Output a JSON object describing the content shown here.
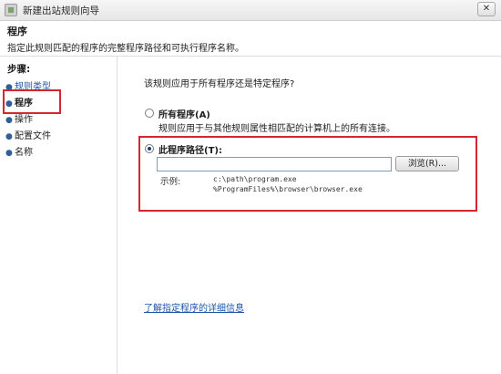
{
  "window": {
    "title": "新建出站规则向导",
    "close_label": "✕"
  },
  "header": {
    "title": "程序",
    "description": "指定此规则匹配的程序的完整程序路径和可执行程序名称。"
  },
  "steps": {
    "title": "步骤:",
    "items": [
      {
        "label": "规则类型",
        "state": "link"
      },
      {
        "label": "程序",
        "state": "active"
      },
      {
        "label": "操作",
        "state": "pending"
      },
      {
        "label": "配置文件",
        "state": "pending"
      },
      {
        "label": "名称",
        "state": "pending"
      }
    ]
  },
  "main": {
    "question": "该规则应用于所有程序还是特定程序?",
    "all_programs": {
      "label": "所有程序(A)",
      "description": "规则应用于与其他规则属性相匹配的计算机上的所有连接。",
      "checked": false
    },
    "program_path": {
      "label": "此程序路径(T):",
      "checked": true,
      "value": "",
      "browse_label": "浏览(R)...",
      "example_label": "示例:",
      "example_lines": [
        "c:\\path\\program.exe",
        "%ProgramFiles%\\browser\\browser.exe"
      ]
    },
    "learn_more": "了解指定程序的详细信息"
  },
  "colors": {
    "highlight_box": "#d4262f",
    "link": "#1c55a8"
  }
}
